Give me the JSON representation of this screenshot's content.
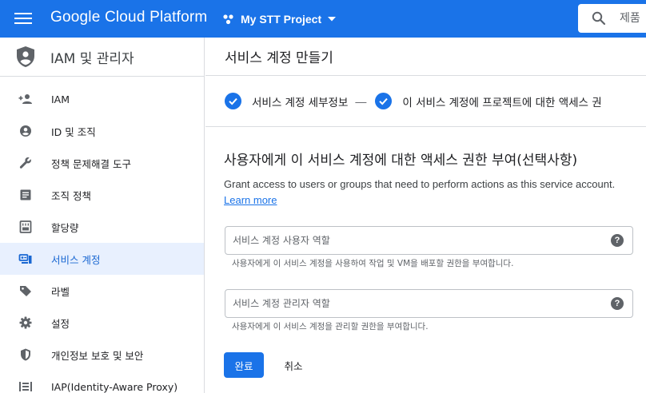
{
  "header": {
    "menu_icon": "hamburger-menu-icon",
    "brand": "Google Cloud Platform",
    "project_name": "My STT Project",
    "search_placeholder": "제품",
    "accent_color": "#1a73e8"
  },
  "sidebar": {
    "title": "IAM 및 관리자",
    "title_icon": "shield-user-icon",
    "items": [
      {
        "label": "IAM",
        "icon": "person-add-icon"
      },
      {
        "label": "ID 및 조직",
        "icon": "account-circle-icon"
      },
      {
        "label": "정책 문제해결 도구",
        "icon": "wrench-icon"
      },
      {
        "label": "조직 정책",
        "icon": "list-document-icon"
      },
      {
        "label": "할당량",
        "icon": "quota-meter-icon"
      },
      {
        "label": "서비스 계정",
        "icon": "service-account-icon",
        "active": true
      },
      {
        "label": "라벨",
        "icon": "label-tag-icon"
      },
      {
        "label": "설정",
        "icon": "gear-icon"
      },
      {
        "label": "개인정보 보호 및 보안",
        "icon": "security-shield-icon"
      },
      {
        "label": "IAP(Identity-Aware Proxy)",
        "icon": "iap-icon"
      }
    ]
  },
  "main": {
    "page_title": "서비스 계정 만들기",
    "steps": [
      {
        "label": "서비스 계정 세부정보",
        "status": "complete"
      },
      {
        "label": "이 서비스 계정에 프로젝트에 대한 액세스 권",
        "status": "complete"
      }
    ],
    "step_separator": "—",
    "section_title": "사용자에게 이 서비스 계정에 대한 액세스 권한 부여(선택사항)",
    "section_desc": "Grant access to users or groups that need to perform actions as this service account.",
    "learn_more": "Learn more",
    "fields": [
      {
        "placeholder": "서비스 계정 사용자 역할",
        "hint": "사용자에게 이 서비스 계정을 사용하여 작업 및 VM을 배포할 권한을 부여합니다.",
        "help": "?"
      },
      {
        "placeholder": "서비스 계정 관리자 역할",
        "hint": "사용자에게 이 서비스 계정을 관리할 권한을 부여합니다.",
        "help": "?"
      }
    ],
    "done_button": "완료",
    "cancel_button": "취소"
  }
}
